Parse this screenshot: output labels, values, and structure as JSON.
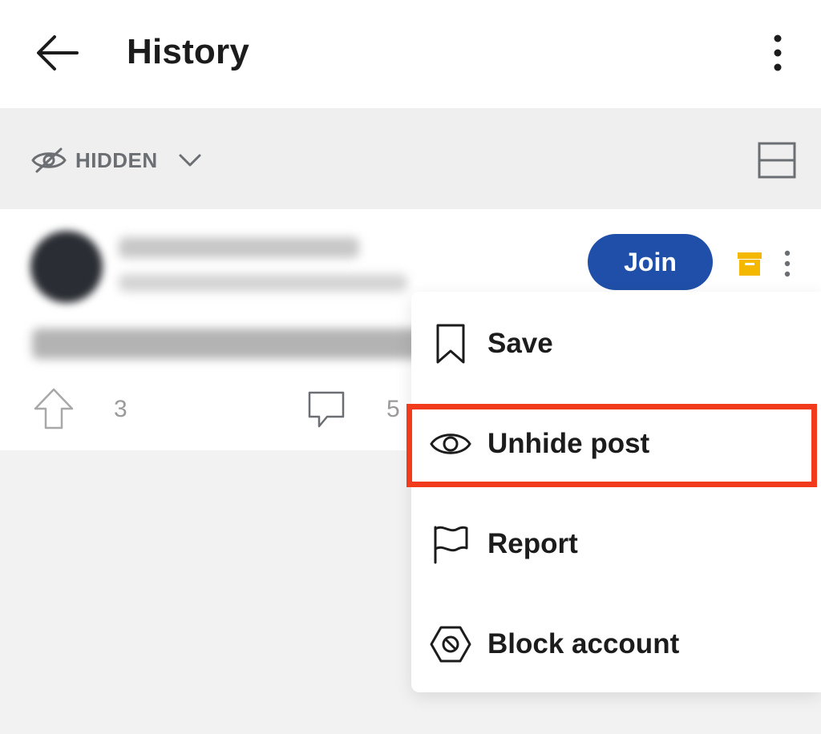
{
  "header": {
    "title": "History",
    "back_icon": "arrow-left-icon",
    "more_icon": "more-vertical-icon"
  },
  "filter": {
    "label": "HIDDEN",
    "icon": "eye-off-icon",
    "chevron_icon": "chevron-down-icon",
    "layout_icon": "card-layout-icon"
  },
  "post": {
    "join_label": "Join",
    "vote_count": "3",
    "comment_count": "5"
  },
  "menu": {
    "items": [
      {
        "label": "Save",
        "icon": "bookmark-icon"
      },
      {
        "label": "Unhide post",
        "icon": "eye-icon",
        "highlighted": true
      },
      {
        "label": "Report",
        "icon": "flag-icon"
      },
      {
        "label": "Block account",
        "icon": "block-icon"
      }
    ]
  },
  "colors": {
    "join_button": "#1f4fa8",
    "highlight_border": "#f23b1d",
    "archive_icon": "#f5b800"
  }
}
